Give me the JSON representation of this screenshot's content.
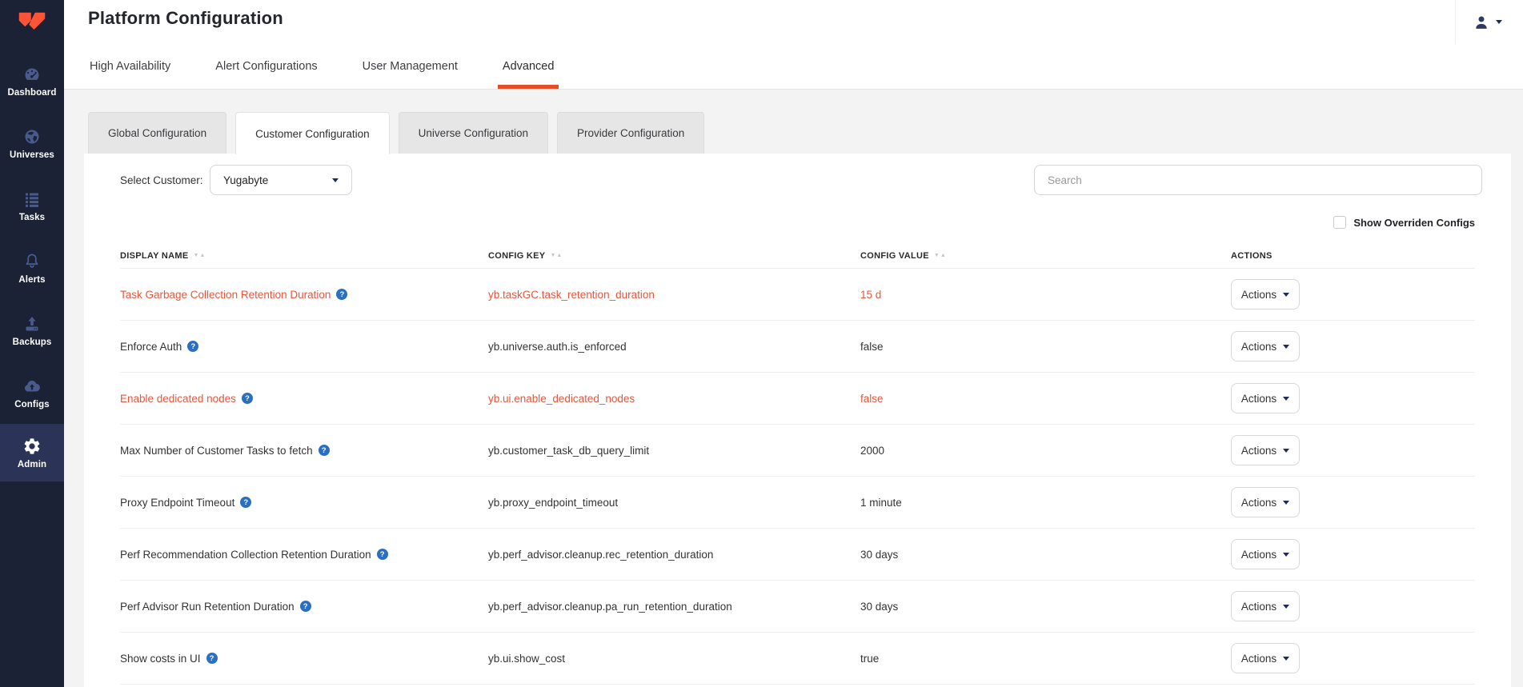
{
  "header": {
    "title": "Platform Configuration"
  },
  "sidebar": {
    "items": [
      {
        "label": "Dashboard",
        "icon": "dashboard-icon",
        "active": false
      },
      {
        "label": "Universes",
        "icon": "universes-icon",
        "active": false
      },
      {
        "label": "Tasks",
        "icon": "tasks-icon",
        "active": false
      },
      {
        "label": "Alerts",
        "icon": "alerts-icon",
        "active": false
      },
      {
        "label": "Backups",
        "icon": "backups-icon",
        "active": false
      },
      {
        "label": "Configs",
        "icon": "configs-icon",
        "active": false
      },
      {
        "label": "Admin",
        "icon": "admin-gear-icon",
        "active": true
      }
    ]
  },
  "tabs": [
    {
      "label": "High Availability",
      "active": false
    },
    {
      "label": "Alert Configurations",
      "active": false
    },
    {
      "label": "User Management",
      "active": false
    },
    {
      "label": "Advanced",
      "active": true
    }
  ],
  "subtabs": [
    {
      "label": "Global Configuration",
      "active": false
    },
    {
      "label": "Customer Configuration",
      "active": true
    },
    {
      "label": "Universe Configuration",
      "active": false
    },
    {
      "label": "Provider Configuration",
      "active": false
    }
  ],
  "toolbar": {
    "select_customer_label": "Select Customer:",
    "customer_value": "Yugabyte",
    "search_placeholder": "Search",
    "show_overridden_label": "Show Overriden Configs",
    "show_overridden_checked": false
  },
  "table": {
    "columns": [
      {
        "label": "DISPLAY NAME",
        "sortable": true
      },
      {
        "label": "CONFIG KEY",
        "sortable": true
      },
      {
        "label": "CONFIG VALUE",
        "sortable": true
      },
      {
        "label": "ACTIONS",
        "sortable": false
      }
    ],
    "sort_glyphs": "▼▲",
    "actions_label": "Actions",
    "rows": [
      {
        "display_name": "Task Garbage Collection Retention Duration",
        "config_key": "yb.taskGC.task_retention_duration",
        "config_value": "15 d",
        "overridden": true
      },
      {
        "display_name": "Enforce Auth",
        "config_key": "yb.universe.auth.is_enforced",
        "config_value": "false",
        "overridden": false
      },
      {
        "display_name": "Enable dedicated nodes",
        "config_key": "yb.ui.enable_dedicated_nodes",
        "config_value": "false",
        "overridden": true
      },
      {
        "display_name": "Max Number of Customer Tasks to fetch",
        "config_key": "yb.customer_task_db_query_limit",
        "config_value": "2000",
        "overridden": false
      },
      {
        "display_name": "Proxy Endpoint Timeout",
        "config_key": "yb.proxy_endpoint_timeout",
        "config_value": "1 minute",
        "overridden": false
      },
      {
        "display_name": "Perf Recommendation Collection Retention Duration",
        "config_key": "yb.perf_advisor.cleanup.rec_retention_duration",
        "config_value": "30 days",
        "overridden": false
      },
      {
        "display_name": "Perf Advisor Run Retention Duration",
        "config_key": "yb.perf_advisor.cleanup.pa_run_retention_duration",
        "config_value": "30 days",
        "overridden": false
      },
      {
        "display_name": "Show costs in UI",
        "config_key": "yb.ui.show_cost",
        "config_value": "true",
        "overridden": false
      }
    ]
  },
  "help_glyph": "?",
  "colors": {
    "accent_underline": "#e64c25",
    "overridden_text": "#e8563c",
    "help_icon_blue": "#2b6fc2",
    "sidebar_bg": "#1b2236",
    "sidebar_active_bg": "#2b3456",
    "sidebar_icon": "#4a5a8c",
    "logo_orange": "#ff5335"
  }
}
